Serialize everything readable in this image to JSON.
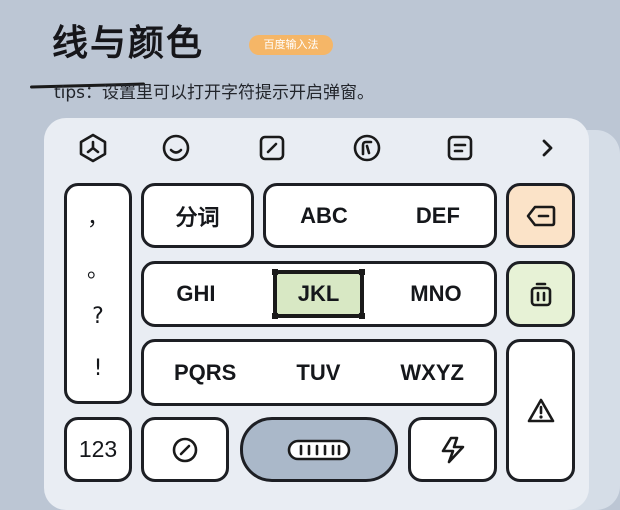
{
  "header": {
    "title": "线与颜色",
    "badge": "百度输入法",
    "tip": "tips：设置里可以打开字符提示开启弹窗。"
  },
  "toolbar": {
    "icons": [
      "hexagon-logo-icon",
      "emoji-smile-icon",
      "edit-square-icon",
      "cursor-circle-icon",
      "clipboard-icon",
      "chevron-right-icon"
    ]
  },
  "keyboard": {
    "punctuation": [
      "，",
      "。",
      "?",
      "!"
    ],
    "row1": {
      "fenci": "分词",
      "abc": "ABC",
      "def": "DEF"
    },
    "row2": {
      "ghi": "GHI",
      "jkl": "JKL",
      "mno": "MNO"
    },
    "row3": {
      "pqrs": "PQRS",
      "tuv": "TUV",
      "wxyz": "WXYZ"
    },
    "bottom": {
      "num": "123"
    }
  },
  "colors": {
    "background": "#bcc6d4",
    "panel": "#e9edf3",
    "badge": "#f5b667",
    "backspace_key": "#fbe3c8",
    "clear_key": "#e7f2d6",
    "space_key": "#aab8c9",
    "jkl_highlight": "#d8e8c4"
  }
}
